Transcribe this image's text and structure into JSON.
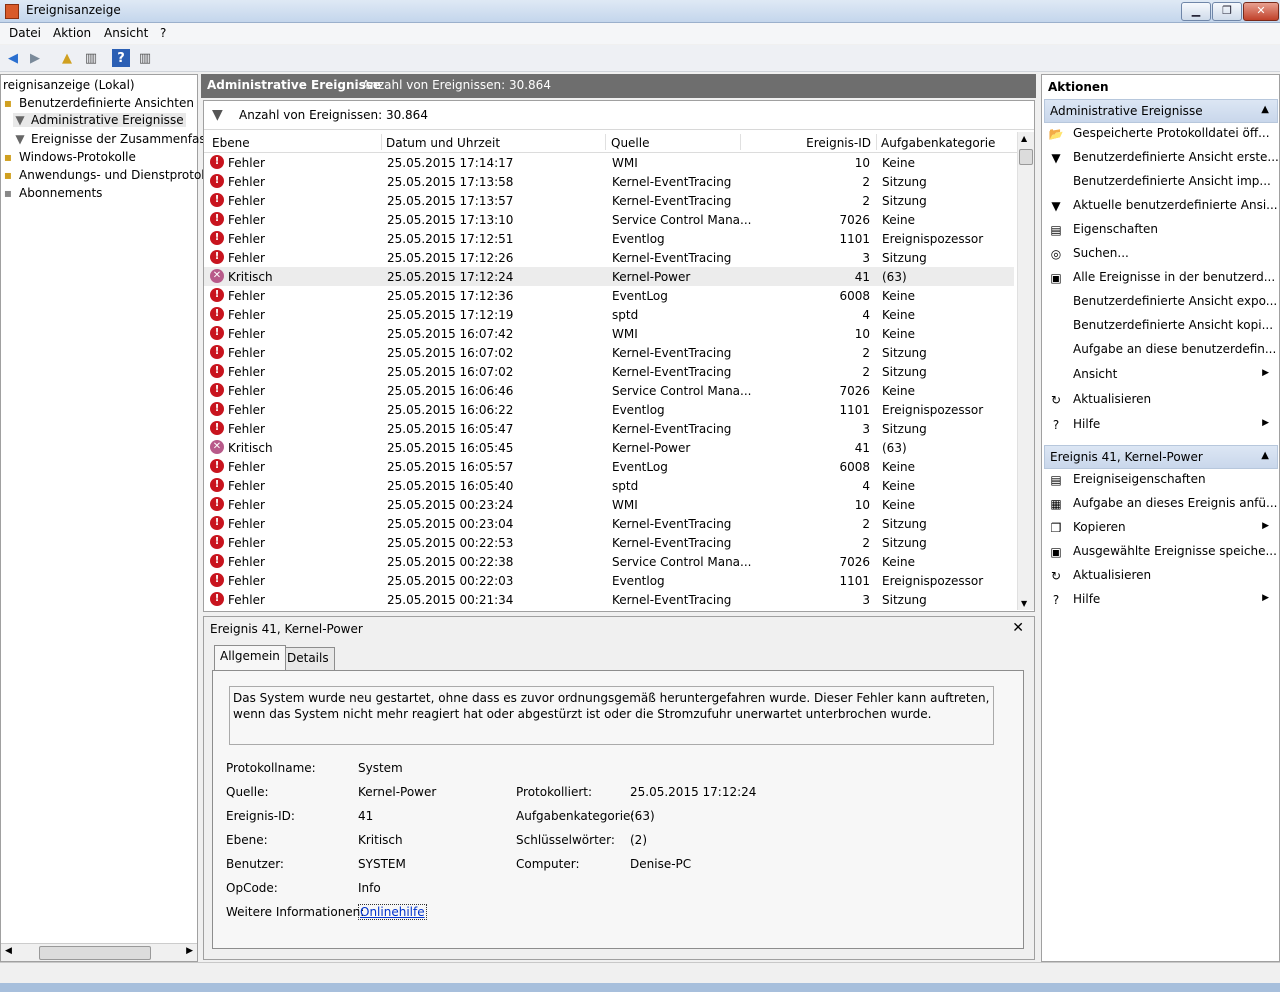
{
  "window": {
    "title": "Ereignisanzeige"
  },
  "menu": [
    "Datei",
    "Aktion",
    "Ansicht",
    "?"
  ],
  "tree": [
    {
      "label": "reignisanzeige (Lokal)",
      "indent": 0,
      "icon": ""
    },
    {
      "label": "Benutzerdefinierte Ansichten",
      "indent": 0,
      "icon": "folder"
    },
    {
      "label": "Administrative Ereignisse",
      "indent": 1,
      "icon": "filter",
      "selected": true
    },
    {
      "label": "Ereignisse der Zusammenfassu",
      "indent": 1,
      "icon": "filter"
    },
    {
      "label": "Windows-Protokolle",
      "indent": 0,
      "icon": "folder"
    },
    {
      "label": "Anwendungs- und Dienstprotokol",
      "indent": 0,
      "icon": "folder"
    },
    {
      "label": "Abonnements",
      "indent": 0,
      "icon": "folder"
    }
  ],
  "header": {
    "title": "Administrative Ereignisse",
    "count": "Anzahl von Ereignissen: 30.864"
  },
  "filter": {
    "text": "Anzahl von Ereignissen: 30.864"
  },
  "columns": [
    "Ebene",
    "Datum und Uhrzeit",
    "Quelle",
    "Ereignis-ID",
    "Aufgabenkategorie"
  ],
  "events": [
    {
      "level": "Fehler",
      "date": "25.05.2015 17:14:17",
      "source": "WMI",
      "id": "10",
      "category": "Keine"
    },
    {
      "level": "Fehler",
      "date": "25.05.2015 17:13:58",
      "source": "Kernel-EventTracing",
      "id": "2",
      "category": "Sitzung"
    },
    {
      "level": "Fehler",
      "date": "25.05.2015 17:13:57",
      "source": "Kernel-EventTracing",
      "id": "2",
      "category": "Sitzung"
    },
    {
      "level": "Fehler",
      "date": "25.05.2015 17:13:10",
      "source": "Service Control Mana...",
      "id": "7026",
      "category": "Keine"
    },
    {
      "level": "Fehler",
      "date": "25.05.2015 17:12:51",
      "source": "Eventlog",
      "id": "1101",
      "category": "Ereignispozessor"
    },
    {
      "level": "Fehler",
      "date": "25.05.2015 17:12:26",
      "source": "Kernel-EventTracing",
      "id": "3",
      "category": "Sitzung"
    },
    {
      "level": "Kritisch",
      "date": "25.05.2015 17:12:24",
      "source": "Kernel-Power",
      "id": "41",
      "category": "(63)",
      "selected": true
    },
    {
      "level": "Fehler",
      "date": "25.05.2015 17:12:36",
      "source": "EventLog",
      "id": "6008",
      "category": "Keine"
    },
    {
      "level": "Fehler",
      "date": "25.05.2015 17:12:19",
      "source": "sptd",
      "id": "4",
      "category": "Keine"
    },
    {
      "level": "Fehler",
      "date": "25.05.2015 16:07:42",
      "source": "WMI",
      "id": "10",
      "category": "Keine"
    },
    {
      "level": "Fehler",
      "date": "25.05.2015 16:07:02",
      "source": "Kernel-EventTracing",
      "id": "2",
      "category": "Sitzung"
    },
    {
      "level": "Fehler",
      "date": "25.05.2015 16:07:02",
      "source": "Kernel-EventTracing",
      "id": "2",
      "category": "Sitzung"
    },
    {
      "level": "Fehler",
      "date": "25.05.2015 16:06:46",
      "source": "Service Control Mana...",
      "id": "7026",
      "category": "Keine"
    },
    {
      "level": "Fehler",
      "date": "25.05.2015 16:06:22",
      "source": "Eventlog",
      "id": "1101",
      "category": "Ereignispozessor"
    },
    {
      "level": "Fehler",
      "date": "25.05.2015 16:05:47",
      "source": "Kernel-EventTracing",
      "id": "3",
      "category": "Sitzung"
    },
    {
      "level": "Kritisch",
      "date": "25.05.2015 16:05:45",
      "source": "Kernel-Power",
      "id": "41",
      "category": "(63)"
    },
    {
      "level": "Fehler",
      "date": "25.05.2015 16:05:57",
      "source": "EventLog",
      "id": "6008",
      "category": "Keine"
    },
    {
      "level": "Fehler",
      "date": "25.05.2015 16:05:40",
      "source": "sptd",
      "id": "4",
      "category": "Keine"
    },
    {
      "level": "Fehler",
      "date": "25.05.2015 00:23:24",
      "source": "WMI",
      "id": "10",
      "category": "Keine"
    },
    {
      "level": "Fehler",
      "date": "25.05.2015 00:23:04",
      "source": "Kernel-EventTracing",
      "id": "2",
      "category": "Sitzung"
    },
    {
      "level": "Fehler",
      "date": "25.05.2015 00:22:53",
      "source": "Kernel-EventTracing",
      "id": "2",
      "category": "Sitzung"
    },
    {
      "level": "Fehler",
      "date": "25.05.2015 00:22:38",
      "source": "Service Control Mana...",
      "id": "7026",
      "category": "Keine"
    },
    {
      "level": "Fehler",
      "date": "25.05.2015 00:22:03",
      "source": "Eventlog",
      "id": "1101",
      "category": "Ereignispozessor"
    },
    {
      "level": "Fehler",
      "date": "25.05.2015 00:21:34",
      "source": "Kernel-EventTracing",
      "id": "3",
      "category": "Sitzung"
    }
  ],
  "detail": {
    "title": "Ereignis 41, Kernel-Power",
    "tabs": [
      "Allgemein",
      "Details"
    ],
    "message": "Das System wurde neu gestartet, ohne dass es zuvor ordnungsgemäß heruntergefahren wurde. Dieser Fehler kann auftreten, wenn das System nicht mehr reagiert hat oder abgestürzt ist oder die Stromzufuhr unerwartet unterbrochen wurde.",
    "fields": {
      "protokollname_label": "Protokollname:",
      "protokollname": "System",
      "quelle_label": "Quelle:",
      "quelle": "Kernel-Power",
      "protokolliert_label": "Protokolliert:",
      "protokolliert": "25.05.2015 17:12:24",
      "id_label": "Ereignis-ID:",
      "id": "41",
      "aufgabe_label": "Aufgabenkategorie:",
      "aufgabe": "(63)",
      "ebene_label": "Ebene:",
      "ebene": "Kritisch",
      "schluessel_label": "Schlüsselwörter:",
      "schluessel": "(2)",
      "benutzer_label": "Benutzer:",
      "benutzer": "SYSTEM",
      "computer_label": "Computer:",
      "computer": "Denise-PC",
      "opcode_label": "OpCode:",
      "opcode": "Info",
      "weitere_label": "Weitere Informationen:",
      "weitere_link": "Onlinehilfe"
    }
  },
  "actions": {
    "title": "Aktionen",
    "section1": "Administrative Ereignisse",
    "items1": [
      {
        "label": "Gespeicherte Protokolldatei öff...",
        "icon": "open-folder-icon",
        "glyph": "📂"
      },
      {
        "label": "Benutzerdefinierte Ansicht erste...",
        "icon": "create-filter-icon",
        "glyph": "▼"
      },
      {
        "label": "Benutzerdefinierte Ansicht imp...",
        "icon": "blank-icon",
        "glyph": ""
      },
      {
        "label": "Aktuelle benutzerdefinierte Ansi...",
        "icon": "filter-icon",
        "glyph": "▼"
      },
      {
        "label": "Eigenschaften",
        "icon": "properties-icon",
        "glyph": "▤"
      },
      {
        "label": "Suchen...",
        "icon": "binoculars-icon",
        "glyph": "◎"
      },
      {
        "label": "Alle Ereignisse in der benutzerd...",
        "icon": "save-icon",
        "glyph": "▣"
      },
      {
        "label": "Benutzerdefinierte Ansicht expo...",
        "icon": "blank-icon",
        "glyph": ""
      },
      {
        "label": "Benutzerdefinierte Ansicht kopi...",
        "icon": "blank-icon",
        "glyph": ""
      },
      {
        "label": "Aufgabe an diese benutzerdefin...",
        "icon": "blank-icon",
        "glyph": ""
      },
      {
        "label": "Ansicht",
        "icon": "blank-icon",
        "glyph": "",
        "submenu": true
      },
      {
        "label": "Aktualisieren",
        "icon": "refresh-icon",
        "glyph": "↻"
      },
      {
        "label": "Hilfe",
        "icon": "help-icon",
        "glyph": "?",
        "submenu": true
      }
    ],
    "section2": "Ereignis 41, Kernel-Power",
    "items2": [
      {
        "label": "Ereigniseigenschaften",
        "icon": "event-properties-icon",
        "glyph": "▤"
      },
      {
        "label": "Aufgabe an dieses Ereignis anfü...",
        "icon": "task-icon",
        "glyph": "▦"
      },
      {
        "label": "Kopieren",
        "icon": "copy-icon",
        "glyph": "❐",
        "submenu": true
      },
      {
        "label": "Ausgewählte Ereignisse speiche...",
        "icon": "save-icon",
        "glyph": "▣"
      },
      {
        "label": "Aktualisieren",
        "icon": "refresh-icon",
        "glyph": "↻"
      },
      {
        "label": "Hilfe",
        "icon": "help-icon",
        "glyph": "?",
        "submenu": true
      }
    ]
  },
  "colors": {
    "error": "#c8141e",
    "critical": "#b85a8a",
    "header_bg": "#6e6e6e",
    "section_bg": "#c9d7eb",
    "link": "#0033cc"
  }
}
